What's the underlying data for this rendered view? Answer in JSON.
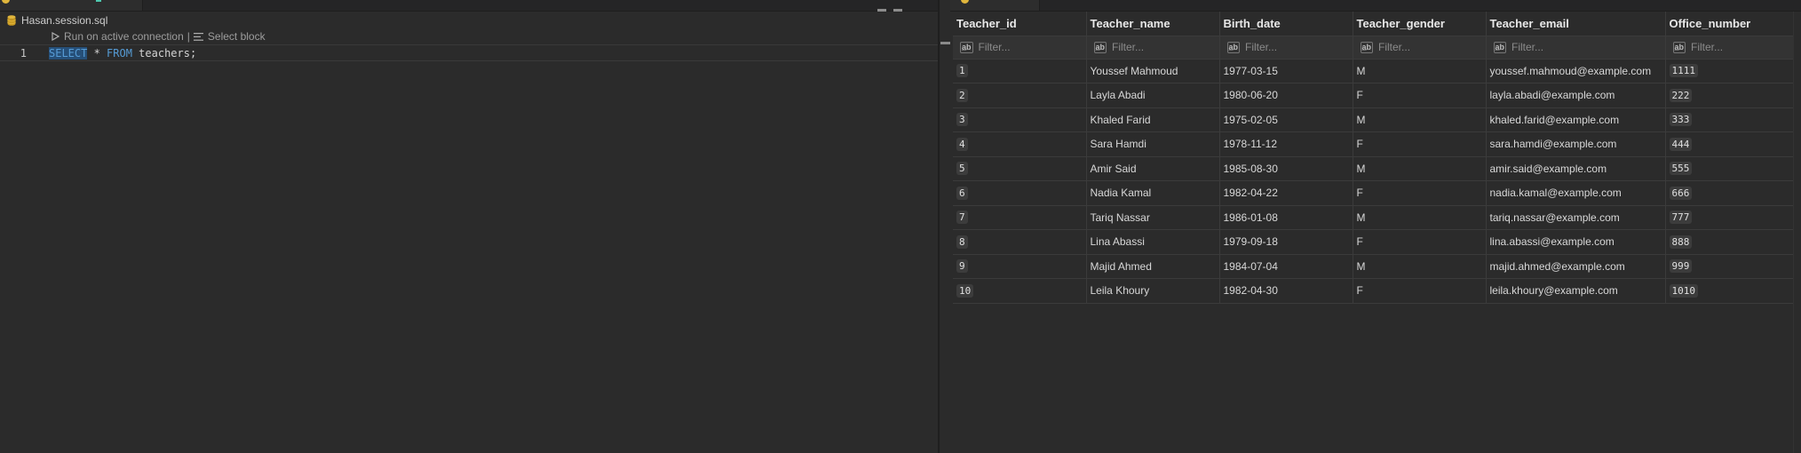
{
  "editor": {
    "breadcrumb_file": "Hasan.session.sql",
    "codelens": {
      "run_label": "Run on active connection",
      "separator": "|",
      "select_label": "Select block"
    },
    "line_number": "1",
    "code": {
      "kw_select": "SELECT",
      "star": " * ",
      "kw_from": "FROM",
      "rest": " teachers;"
    }
  },
  "results": {
    "columns": [
      "Teacher_id",
      "Teacher_name",
      "Birth_date",
      "Teacher_gender",
      "Teacher_email",
      "Office_number"
    ],
    "filter_placeholder": "Filter...",
    "rows": [
      [
        "1",
        "Youssef Mahmoud",
        "1977-03-15",
        "M",
        "youssef.mahmoud@example.com",
        "1111"
      ],
      [
        "2",
        "Layla Abadi",
        "1980-06-20",
        "F",
        "layla.abadi@example.com",
        "222"
      ],
      [
        "3",
        "Khaled Farid",
        "1975-02-05",
        "M",
        "khaled.farid@example.com",
        "333"
      ],
      [
        "4",
        "Sara Hamdi",
        "1978-11-12",
        "F",
        "sara.hamdi@example.com",
        "444"
      ],
      [
        "5",
        "Amir Said",
        "1985-08-30",
        "M",
        "amir.said@example.com",
        "555"
      ],
      [
        "6",
        "Nadia Kamal",
        "1982-04-22",
        "F",
        "nadia.kamal@example.com",
        "666"
      ],
      [
        "7",
        "Tariq Nassar",
        "1986-01-08",
        "M",
        "tariq.nassar@example.com",
        "777"
      ],
      [
        "8",
        "Lina Abassi",
        "1979-09-18",
        "F",
        "lina.abassi@example.com",
        "888"
      ],
      [
        "9",
        "Majid Ahmed",
        "1984-07-04",
        "M",
        "majid.ahmed@example.com",
        "999"
      ],
      [
        "10",
        "Leila Khoury",
        "1982-04-30",
        "F",
        "leila.khoury@example.com",
        "1010"
      ]
    ]
  },
  "icons": {
    "database": "database-icon",
    "run": "play-icon",
    "select_block": "lines-icon",
    "filter": "abc-filter-icon"
  },
  "colors": {
    "background": "#2b2b2b",
    "keyword": "#569cd6",
    "selection": "#264f78",
    "db_icon": "#e0b63c"
  }
}
